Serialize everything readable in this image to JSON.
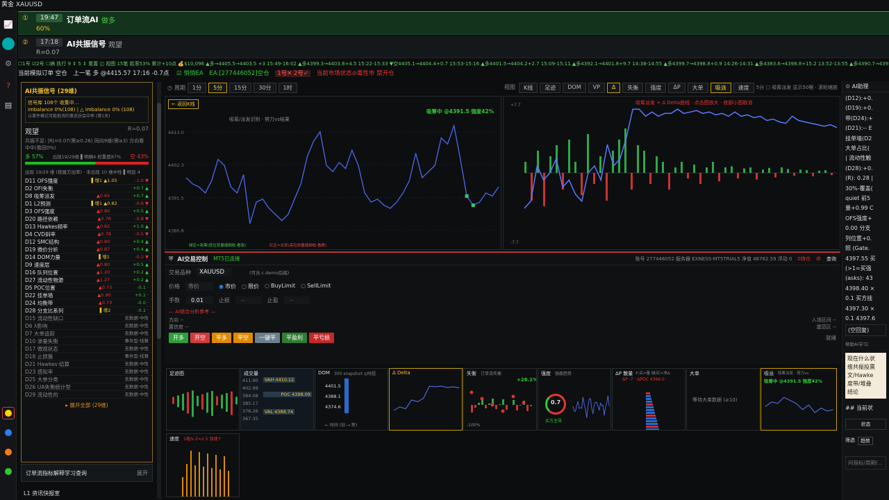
{
  "window": {
    "title": "黄金 XAUUSD"
  },
  "signal1": {
    "index": "①",
    "time": "19:47",
    "name": "订单流AI",
    "direction": "做多",
    "confidence": "60%"
  },
  "signal2": {
    "index": "②",
    "time": "17:18",
    "name": "AI共振信号",
    "direction": "观望",
    "r": "R=0.07"
  },
  "ticker": {
    "text": "☐1号 ☑2号 ☐搞 执行 9 ⇕ 5 ⇕ 重置 ◫ 视图 15笔 胜率53% 累计+10点 💰$10,096 ▲多→4405.5→4403.5 +3 15:49-16:02 ▲多4399.3→4403.8+4.5 15:22-15:33 ▼空4405.1→4404.4+0.7 15:53-15:16 ▲多4401.5→4404.2+2.7 15:09-15:11 ▲多4392.1→4401.8+9.7 14:38-14:55 ▲多4399.7→4398.8+0.9 14:26-14:31 ▲多4383.6→4398.8+15.2 13:52-13:55 ▲多4390.7→4395.5+4.8 13:30-13:34 ▲多4401.1→4394.9+6.2 13:13-13:1"
  },
  "status": {
    "left": "当前模拟订单 空仓",
    "last": "上一笔 多 @4415.57 17:16 -0.7点",
    "ea_toggle": "☑ 悄悄EA",
    "ea": "EA:[277446052]空仓",
    "slot": "1号✕ 2号✓",
    "state": "当前市场状态⊘毒性市 禁开仓"
  },
  "left_panel": {
    "header": "AI共振信号 (29维)",
    "info1": "信号库 108个 收集中…",
    "info2": "imbalance 0%(108) | △ imbalance 0% (108)",
    "info3": "以事件模式可能抵消的事态份会中率 (第1天)",
    "status": "观望",
    "r": "R=0.07",
    "detail": "共振不足: |R|=0.07(需≥0.26) 同向9维(需≥3) 方向看中中(看回0%)",
    "long_pct": "多 57%",
    "mid": "出现19/29维 ▌明确4 权重度87%",
    "short_pct": "空 43%",
    "sub": "出现 19/29 维 (按属方加率) · 未出现 10 维中性 ▌明显 4",
    "rows": [
      [
        "D11 OFS强度",
        "▌增1 ▲1.05",
        "-1.0 ▼"
      ],
      [
        "D2 OFI失衡",
        "",
        "+0.7 ▲"
      ],
      [
        "D8 吸筹派发",
        "▲0.65",
        "+0.7 ▲"
      ],
      [
        "D1 L2预测",
        "▌增1 ▲0.82",
        "-0.6 ▼"
      ],
      [
        "D3 OFS强度",
        "▲0.80",
        "+0.5 ▲"
      ],
      [
        "D20 路径依赖",
        "▲0.78",
        "-0.8 ▼"
      ],
      [
        "D13 Hawkes频率",
        "▲0.82",
        "+1.0 ▲"
      ],
      [
        "D4 CVD斜率",
        "▲0.78",
        "-0.5 ▼"
      ],
      [
        "D12 SMC结构",
        "▲0.80",
        "+0.4 ▲"
      ],
      [
        "D19 微价分析",
        "▲0.87",
        "+0.4 ▲"
      ],
      [
        "D14 DOM力量",
        "▌增1",
        "-0.2 ▼"
      ],
      [
        "D9 速度层",
        "▲0.80",
        "+0.5 ▲"
      ],
      [
        "D16 队列位置",
        "▲1.20",
        "+0.2 ▲"
      ],
      [
        "D27 流动性物源",
        "▲1.27",
        "+0.2 ▲"
      ],
      [
        "D5 POC位置",
        "▲0.73",
        "-0.1 ·"
      ],
      [
        "D22 挂单墙",
        "▲0.90",
        "+0.1 ·"
      ],
      [
        "D24 均衡带",
        "▲0.73",
        "-0.0 ·"
      ],
      [
        "D28 分支比系列",
        "▌增2",
        "-0.1 ·"
      ],
      [
        "D15 流动性缺口",
        "",
        "无数据·中性"
      ],
      [
        "D6 λ影响",
        "",
        "无数据·中性"
      ],
      [
        "D7 大单追踪",
        "",
        "无数据·中性"
      ],
      [
        "D10 渗量失衡",
        "",
        "事件型·结算"
      ],
      [
        "D17 微观状态",
        "",
        "无数据·中性"
      ],
      [
        "D18 止损簇",
        "",
        "事件型·结算"
      ],
      [
        "D21 Hawkes·结算",
        "",
        "无数据·中性"
      ],
      [
        "D23 感知率",
        "",
        "无数据·中性"
      ],
      [
        "D25 大单分类",
        "",
        "无数据·中性"
      ],
      [
        "D26 UA失衡统计型",
        "",
        "无数据·中性"
      ],
      [
        "D29 流动性的",
        "",
        "无数据·中性"
      ]
    ],
    "expand": "▸ 展开全部 (29维)",
    "learn": "订单流指标解释学习查询",
    "learn_btn": "展开",
    "bottom": "L1 资讯快报室"
  },
  "toolbar": {
    "period_label": "周期",
    "periods": [
      "1分",
      "5分",
      "15分",
      "30分",
      "1时"
    ],
    "views": [
      "视图",
      "K线",
      "足迹",
      "DOM",
      "VP",
      "Δ",
      "失衡",
      "强度",
      "ΔP",
      "大单",
      "吸派",
      "速度"
    ],
    "extra": "5分 ▢ 吸筹派发 显示50根 · 滚轮缩放"
  },
  "chart_data": [
    {
      "type": "line",
      "title": "吸筹/派发识别 · 努力vs结果",
      "back": "← 返回K线",
      "badge": "吸筹中 @4391.5 强度42%",
      "yticks": [
        "4413.0",
        "4402.3",
        "4391.5",
        "4380.8"
      ],
      "ylim": [
        4378,
        4420
      ],
      "values": [
        4398,
        4396,
        4395,
        4393,
        4397,
        4404,
        4402,
        4395,
        4393,
        4399,
        4383,
        4390,
        4391,
        4388,
        4386,
        4384,
        4386,
        4391,
        4396,
        4405,
        4410,
        4413,
        4402,
        4400,
        4403,
        4401,
        4407,
        4402,
        4393,
        4390,
        4391,
        4389,
        4388,
        4390,
        4393,
        4397,
        4406,
        4398,
        4400,
        4402,
        4411,
        4409,
        4415,
        4404,
        4392,
        4389,
        4390,
        4393,
        4392,
        4395
      ],
      "legend": [
        "绿区=吸筹(低位变量缩细收·看涨)",
        "红区=派发(高位放量缩细收·看跌)"
      ]
    },
    {
      "type": "line",
      "title": "吸筹派发 + Δ Delta曲线 · 点击图放大 · 底部小图取消",
      "ytop": "+7.7",
      "ybot": "-7.7",
      "values": [
        0.25,
        0.3,
        0.55,
        0.45,
        0.5,
        0.6,
        0.4,
        0.45,
        0.35,
        0.3,
        0.5,
        0.55,
        0.45,
        0.7,
        0.55,
        0.6,
        0.75,
        0.95,
        0.95,
        0.9,
        0.93,
        0.9,
        0.92,
        0.92,
        0.95,
        0.92,
        0.93,
        0.94,
        0.92,
        0.93,
        0.91,
        0.92,
        0.9,
        0.93,
        0.9,
        0.91,
        0.89,
        0.9,
        0.87,
        0.88,
        0.86,
        0.85,
        0.9,
        0.87,
        0.86,
        0.85,
        0.84,
        0.83,
        0.84,
        0.82
      ],
      "deltas": [
        0.2,
        -0.5,
        0.4,
        -0.6,
        0.3,
        0.5,
        -0.3,
        0.6,
        0.2,
        -0.4,
        0.7,
        -0.2,
        0.3,
        -0.5,
        0.4,
        0.6,
        0.8,
        -0.3,
        0.5,
        0.4,
        -0.2,
        0.3,
        0.2,
        -0.3,
        0.1,
        0.2,
        -0.1,
        0.15,
        -0.2,
        0.1,
        0.2,
        -0.15,
        0.1,
        0.12,
        -0.1,
        0.08,
        0.1,
        -0.12,
        0.06,
        0.09,
        -0.08,
        0.1,
        0.07,
        -0.05,
        0.06,
        0.05,
        -0.06,
        0.04,
        0.05,
        -0.04
      ]
    }
  ],
  "trade": {
    "title": "AI交易控制",
    "mt5": "MT5已连接",
    "acct": "账号 277446052 服务器 EXNESS-MT5TRIAL5 净值 46762.59 浮动 0",
    "close_lbl": "0持仓",
    "query": "查询",
    "symbol_label": "交易品种",
    "symbol": "XAUUSD",
    "symbol_hint": "(可含.c.demo后缀)",
    "price_label": "价格",
    "price_ph": "市价",
    "order_types": [
      "市价",
      "限价",
      "BuyLimit",
      "SellLimit"
    ],
    "qty_label": "手数",
    "qty": "0.01",
    "sl_label": "止损",
    "sl": "--",
    "tp_label": "止盈",
    "tp": "--",
    "ref": "— AI综合分析参考 —",
    "dir": "方向 --",
    "conf": "置信度 --",
    "entry": "入场区间 --",
    "tp_zone": "震范区 --",
    "status": "就绪",
    "buttons": [
      [
        "开多",
        "#2f9e3a"
      ],
      [
        "开空",
        "#d33b3b"
      ],
      [
        "平多",
        "#e08a00"
      ],
      [
        "平空",
        "#e08a00"
      ],
      [
        "一键平",
        "#6b7f8c"
      ],
      [
        "平盈利",
        "#2f7d32"
      ],
      [
        "平亏损",
        "#c62828"
      ]
    ]
  },
  "cards": [
    {
      "name": "足迹图",
      "sub": ""
    },
    {
      "name": "成交量",
      "sub": "",
      "lines": [
        "VAH 4410.12",
        "POC 4398.09",
        "VAL 4388.74"
      ],
      "ticks": [
        "411.90",
        "402.99",
        "394.08",
        "385.17",
        "376.26",
        "367.35"
      ]
    },
    {
      "name": "DOM",
      "sub": "300 snapshot ◎时超",
      "ticks": [
        "4401.5",
        "4388.1",
        "4374.6"
      ],
      "foot": "← 时间 (旧 → 新)"
    },
    {
      "name": "Δ Delta",
      "sub": ""
    },
    {
      "name": "失衡",
      "sub": "订单流失衡",
      "val": "+26.1%",
      "pct": "-100%"
    },
    {
      "name": "强度",
      "sub": "强度趋势",
      "gauge": "0.7",
      "gauge_lbl": "买方主导"
    },
    {
      "name": "ΔP 散量",
      "sub": "P:买=量 绿/红=净Δ",
      "ap": "ΔP -7 · ΔPOC 4396.0"
    },
    {
      "name": "大单",
      "sub": "",
      "wait": "等待大单数据 (≥10)"
    },
    {
      "name": "吸派",
      "sub": "吸筹派发 · 努力vs",
      "badge": "吸筹中 @4391.5 强度42%"
    },
    {
      "name": "速度",
      "sub": "1毫/s Z=2.5 加速↑"
    }
  ],
  "right_panel": {
    "title": "AI助理",
    "lines": [
      "(D12):+0.",
      "(D19):+0.",
      "带(D24):+",
      "(D21):-- E",
      "挂单墙(D2",
      "大单占比(",
      "| 流动性触",
      "(D28):+0.",
      "(R): 0.28 |",
      "30%-覆盖(",
      "quiet 前5",
      "量+0.99 C",
      "OFS强度+",
      "0.00 分支",
      "列位置+0.",
      "照 (Gate.",
      "4397.55 买",
      "(>1=买强",
      "(asks): 43",
      "4398.40 ×",
      "0.1 买方挂",
      "4397.30 ×",
      "0.1 4397.6"
    ],
    "mode": "(空回复)",
    "help": "帮助AI学习:",
    "q": "现在什么状",
    "q2": "维共振投票",
    "q3": "文/Hawke",
    "q4": "度带/堆叠",
    "q5": "结论",
    "cur": "## 当前状",
    "status": "状态",
    "tab1": "筛选",
    "tab2": "趋势",
    "input_ph": "问指标/周期/..."
  }
}
